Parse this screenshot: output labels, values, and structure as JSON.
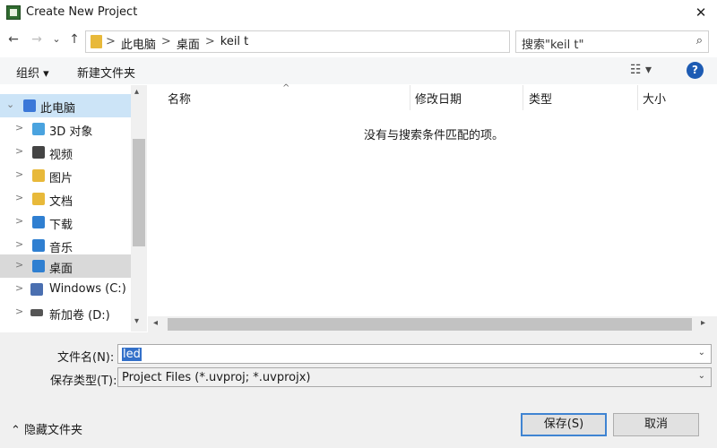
{
  "window": {
    "title": "Create New Project",
    "close_glyph": "✕"
  },
  "address_bar": {
    "back": "←",
    "forward": "→",
    "recent": "⌄",
    "up": "↑",
    "crumbs": [
      ">",
      "此电脑",
      ">",
      "桌面",
      ">",
      "keil t"
    ],
    "dropdown": "⌄",
    "refresh": "↻"
  },
  "search": {
    "placeholder": "搜索\"keil t\"",
    "icon": "⌕"
  },
  "toolbar": {
    "organize_label": "组织 ▾",
    "new_folder_label": "新建文件夹",
    "view_glyph": "☷ ▾",
    "help_glyph": "?"
  },
  "nav_pane": {
    "items": [
      {
        "label": "此电脑",
        "chevron": "⌄",
        "icon": "computer-icon",
        "color": "#3b78d8"
      },
      {
        "label": "3D 对象",
        "chevron": ">",
        "icon": "3d-objects-icon",
        "color": "#4aa3df"
      },
      {
        "label": "视频",
        "chevron": ">",
        "icon": "video-icon",
        "color": "#444444"
      },
      {
        "label": "图片",
        "chevron": ">",
        "icon": "pictures-icon",
        "color": "#e8b93a"
      },
      {
        "label": "文档",
        "chevron": ">",
        "icon": "documents-icon",
        "color": "#e8b93a"
      },
      {
        "label": "下载",
        "chevron": ">",
        "icon": "downloads-icon",
        "color": "#2f7fd1"
      },
      {
        "label": "音乐",
        "chevron": ">",
        "icon": "music-icon",
        "color": "#2f7fd1"
      },
      {
        "label": "桌面",
        "chevron": ">",
        "icon": "desktop-icon",
        "color": "#2f7fd1"
      },
      {
        "label": "Windows (C:)",
        "chevron": ">",
        "icon": "drive-c-icon",
        "color": "#4a6fb0"
      },
      {
        "label": "新加卷 (D:)",
        "chevron": ">",
        "icon": "drive-d-icon",
        "color": "#555555"
      }
    ]
  },
  "file_list": {
    "columns": [
      "名称",
      "修改日期",
      "类型",
      "大小"
    ],
    "sort_glyph": "^",
    "empty_message": "没有与搜索条件匹配的项。"
  },
  "scrollbars": {
    "up": "▴",
    "down": "▾",
    "left": "◂",
    "right": "▸"
  },
  "form": {
    "filename_label": "文件名(N):",
    "filename_value": "led",
    "filetype_label": "保存类型(T):",
    "filetype_value": "Project Files (*.uvproj; *.uvprojx)",
    "drop_glyph": "⌄"
  },
  "footer": {
    "hide_folders_label": "⌃  隐藏文件夹",
    "save_label": "保存(S)",
    "cancel_label": "取消"
  }
}
